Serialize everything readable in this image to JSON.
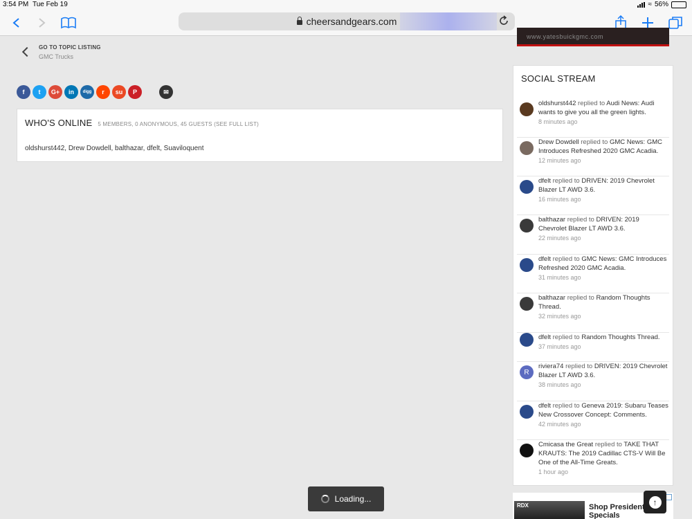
{
  "status": {
    "time": "3:54 PM",
    "date": "Tue Feb 19",
    "battery": "56%",
    "battery_level": 0.56
  },
  "browser": {
    "url": "cheersandgears.com"
  },
  "back": {
    "label": "GO TO TOPIC LISTING",
    "sub": "GMC Trucks"
  },
  "share_icons": [
    {
      "name": "facebook-icon",
      "glyph": "f",
      "color": "#3b5998"
    },
    {
      "name": "twitter-icon",
      "glyph": "t",
      "color": "#1da1f2"
    },
    {
      "name": "googleplus-icon",
      "glyph": "G+",
      "color": "#dd4b39"
    },
    {
      "name": "linkedin-icon",
      "glyph": "in",
      "color": "#0077b5"
    },
    {
      "name": "digg-icon",
      "glyph": "digg",
      "color": "#1e6aa8"
    },
    {
      "name": "reddit-icon",
      "glyph": "r",
      "color": "#ff4500"
    },
    {
      "name": "stumbleupon-icon",
      "glyph": "su",
      "color": "#eb4924"
    },
    {
      "name": "pinterest-icon",
      "glyph": "P",
      "color": "#cb2027"
    }
  ],
  "online": {
    "title": "WHO'S ONLINE",
    "meta": "5 MEMBERS, 0 ANONYMOUS, 45 GUESTS",
    "see_full": "(SEE FULL LIST)",
    "names": "oldshurst442, Drew Dowdell, balthazar, dfelt, Suaviloquent"
  },
  "ad_top": {
    "text": "www.yatesbuickgmc.com"
  },
  "stream": {
    "title": "SOCIAL STREAM",
    "items": [
      {
        "user": "oldshurst442",
        "action": "replied to",
        "topic": "Audi News: Audi wants to give you all the green lights.",
        "time": "8 minutes ago",
        "avatar": "#5a3a20"
      },
      {
        "user": "Drew Dowdell",
        "action": "replied to",
        "topic": "GMC News: GMC Introduces Refreshed 2020 GMC Acadia.",
        "time": "12 minutes ago",
        "avatar": "#7a6a60"
      },
      {
        "user": "dfelt",
        "action": "replied to",
        "topic": "DRIVEN: 2019 Chevrolet Blazer LT AWD 3.6.",
        "time": "16 minutes ago",
        "avatar": "#2a4a8a"
      },
      {
        "user": "balthazar",
        "action": "replied to",
        "topic": "DRIVEN: 2019 Chevrolet Blazer LT AWD 3.6.",
        "time": "22 minutes ago",
        "avatar": "#3a3a3a"
      },
      {
        "user": "dfelt",
        "action": "replied to",
        "topic": "GMC News: GMC Introduces Refreshed 2020 GMC Acadia.",
        "time": "31 minutes ago",
        "avatar": "#2a4a8a"
      },
      {
        "user": "balthazar",
        "action": "replied to",
        "topic": "Random Thoughts Thread.",
        "time": "32 minutes ago",
        "avatar": "#3a3a3a"
      },
      {
        "user": "dfelt",
        "action": "replied to",
        "topic": "Random Thoughts Thread.",
        "time": "37 minutes ago",
        "avatar": "#2a4a8a"
      },
      {
        "user": "riviera74",
        "action": "replied to",
        "topic": "DRIVEN: 2019 Chevrolet Blazer LT AWD 3.6.",
        "time": "38 minutes ago",
        "avatar": "#5c6bc0",
        "letter": "R"
      },
      {
        "user": "dfelt",
        "action": "replied to",
        "topic": "Geneva 2019: Subaru Teases New Crossover Concept: Comments.",
        "time": "42 minutes ago",
        "avatar": "#2a4a8a"
      },
      {
        "user": "Cmicasa the Great",
        "action": "replied to",
        "topic": "TAKE THAT KRAUTS: The 2019 Cadillac CTS-V Will Be One of the All-Time Greats.",
        "time": "1 hour ago",
        "avatar": "#111111"
      }
    ]
  },
  "ad_bottom": {
    "badge": "RDX",
    "text": "Shop Presidential Specials"
  },
  "loading": "Loading..."
}
